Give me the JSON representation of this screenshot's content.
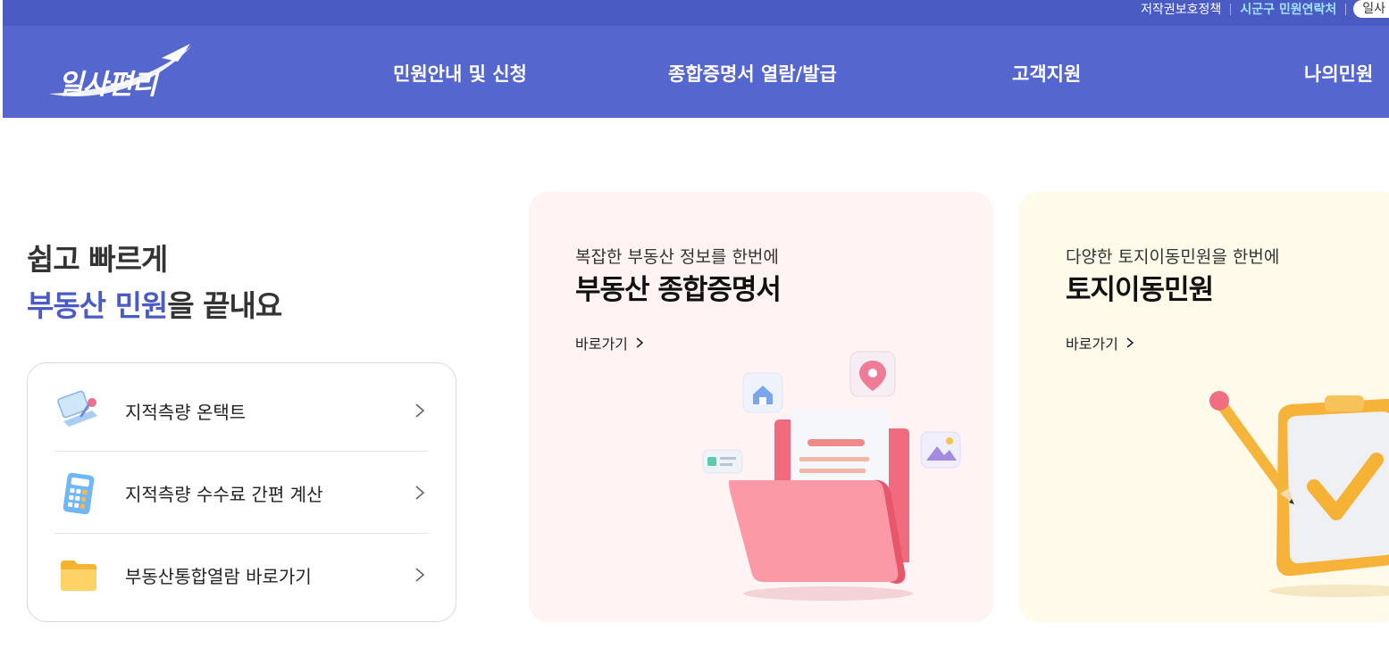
{
  "top_links": {
    "copyright": "저작권보호정책",
    "contact": "시군구 민원연락처",
    "pill": "일사"
  },
  "logo": {
    "text": "일사편리"
  },
  "nav": [
    {
      "label": "민원안내 및 신청"
    },
    {
      "label": "종합증명서 열람/발급"
    },
    {
      "label": "고객지원"
    },
    {
      "label": "나의민원"
    }
  ],
  "hero": {
    "line1": "쉽고 빠르게",
    "line2_accent": "부동산 민원",
    "line2_rest": "을 끝내요"
  },
  "quick_links": [
    {
      "label": "지적측량 온택트",
      "icon": "laptop-icon"
    },
    {
      "label": "지적측량 수수료 간편 계산",
      "icon": "calculator-icon"
    },
    {
      "label": "부동산통합열람 바로가기",
      "icon": "folder-icon"
    }
  ],
  "cards": [
    {
      "subtitle": "복잡한 부동산 정보를 한번에",
      "title": "부동산 종합증명서",
      "link": "바로가기",
      "icon": "document-folder-icon"
    },
    {
      "subtitle": "다양한 토지이동민원을 한번에",
      "title": "토지이동민원",
      "link": "바로가기",
      "icon": "clipboard-pencil-icon"
    }
  ],
  "colors": {
    "topbar": "#4a5bc4",
    "navbar": "#5566cf",
    "accent": "#4a5bc4",
    "card_pink": "#fff3f4",
    "card_cream": "#fffaea"
  }
}
